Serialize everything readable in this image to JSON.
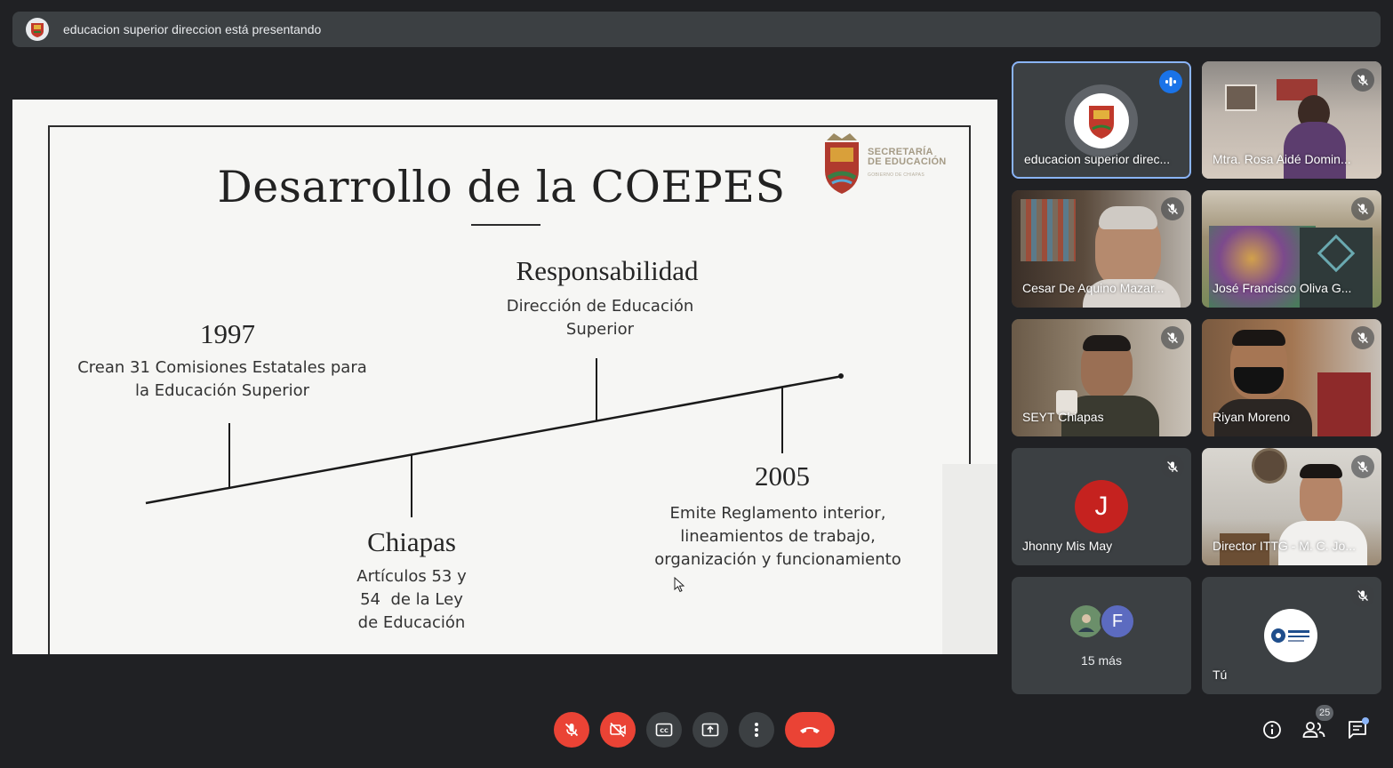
{
  "banner": {
    "text": "educacion superior direccion está presentando"
  },
  "slide": {
    "title": "Desarrollo de la COEPES",
    "logo_line1": "SECRETARÍA",
    "logo_line2": "DE EDUCACIÓN",
    "logo_line3": "GOBIERNO DE CHIAPAS",
    "events": [
      {
        "heading": "1997",
        "body": [
          "Crean 31 Comisiones Estatales para",
          "la Educación Superior"
        ]
      },
      {
        "heading": "Chiapas",
        "body": [
          "Artículos 53 y",
          "54  de la Ley",
          "de Educación"
        ]
      },
      {
        "heading": "Responsabilidad",
        "body": [
          "Dirección de Educación",
          "Superior"
        ]
      },
      {
        "heading": "2005",
        "body": [
          "Emite Reglamento interior,",
          "lineamientos de trabajo,",
          "organización y funcionamiento"
        ]
      }
    ]
  },
  "participants": [
    {
      "name": "educacion superior direc...",
      "state": "speaking"
    },
    {
      "name": "Mtra. Rosa Aidé Domin...",
      "state": "muted"
    },
    {
      "name": "Cesar De Aquino Mazar...",
      "state": "muted"
    },
    {
      "name": "José Francisco Oliva G...",
      "state": "muted"
    },
    {
      "name": "SEYT Chiapas",
      "state": "muted"
    },
    {
      "name": "Riyan Moreno",
      "state": "muted"
    },
    {
      "name": "Jhonny Mis May",
      "state": "muted",
      "initial": "J"
    },
    {
      "name": "Director ITTG - M. C. Jo...",
      "state": "muted"
    },
    {
      "name": "Tú",
      "state": "muted"
    }
  ],
  "more": {
    "label": "15 más",
    "initial": "F"
  },
  "controls": {
    "participants_count": "25"
  },
  "colors": {
    "accent": "#8ab4f8",
    "danger": "#ea4335",
    "tile": "#3c4043",
    "background": "#202124",
    "jhonny_avatar": "#c5221f"
  }
}
